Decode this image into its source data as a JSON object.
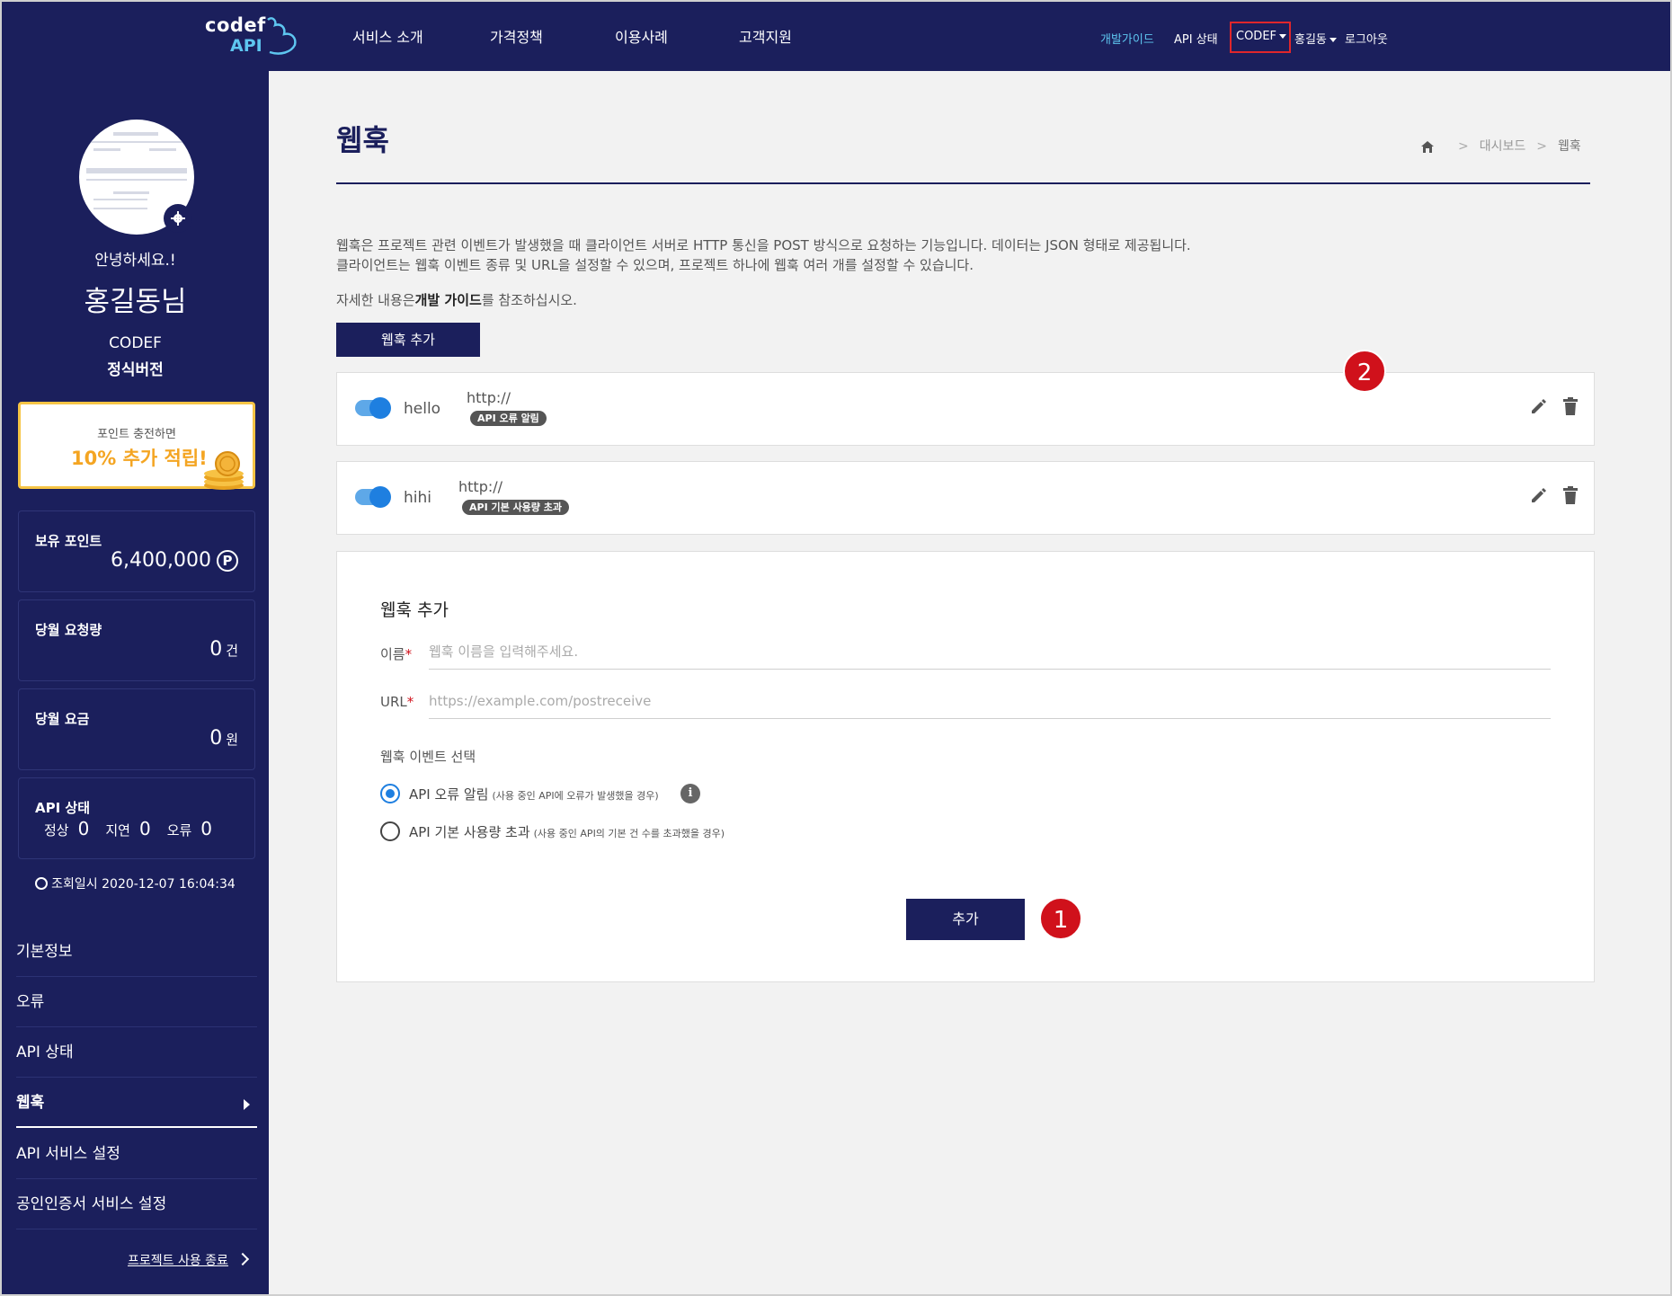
{
  "topnav": {
    "logo_top": "codef",
    "logo_bottom": "API",
    "menu": [
      "서비스 소개",
      "가격정책",
      "이용사례",
      "고객지원"
    ],
    "dev_guide": "개발가이드",
    "api_status": "API 상태",
    "codef": "CODEF",
    "user": "홍길동",
    "logout": "로그아웃"
  },
  "sidebar": {
    "greeting": "안녕하세요.!",
    "username": "홍길동님",
    "plan_name": "CODEF",
    "plan_type": "정식버전",
    "promo_line1": "포인트 충전하면",
    "promo_line2": "10% 추가 적립!",
    "points_label": "보유 포인트",
    "points_value": "6,400,000",
    "points_unit": "P",
    "requests_label": "당월 요청량",
    "requests_value": "0",
    "requests_unit": "건",
    "fee_label": "당월 요금",
    "fee_value": "0",
    "fee_unit": "원",
    "api_status_label": "API 상태",
    "status_normal_label": "정상",
    "status_normal": "0",
    "status_delay_label": "지연",
    "status_delay": "0",
    "status_error_label": "오류",
    "status_error": "0",
    "checked_at": "조회일시 2020-12-07 16:04:34",
    "menu": [
      {
        "label": "기본정보"
      },
      {
        "label": "오류"
      },
      {
        "label": "API 상태"
      },
      {
        "label": "웹훅"
      },
      {
        "label": "API 서비스 설정"
      },
      {
        "label": "공인인증서 서비스 설정"
      }
    ],
    "end_project": "프로젝트 사용 종료"
  },
  "main": {
    "title": "웹훅",
    "breadcrumb": [
      "대시보드",
      "웹훅"
    ],
    "desc_line1": "웹훅은 프로젝트 관련 이벤트가 발생했을 때 클라이언트 서버로 HTTP 통신을 POST 방식으로 요청하는 기능입니다. 데이터는 JSON 형태로 제공됩니다.",
    "desc_line2": "클라이언트는 웹훅 이벤트 종류 및 URL을 설정할 수 있으며, 프로젝트 하나에 웹훅 여러 개를 설정할 수 있습니다.",
    "guide_prefix": "자세한 내용은",
    "guide_link": "개발 가이드",
    "guide_suffix": "를 참조하십시오.",
    "add_button": "웹훅 추가",
    "hooks": [
      {
        "name": "hello",
        "url": "http://",
        "tag": "API 오류 알림",
        "enabled": true
      },
      {
        "name": "hihi",
        "url": "http://",
        "tag": "API 기본 사용량 초과",
        "enabled": true
      }
    ],
    "form": {
      "title": "웹훅 추가",
      "name_label": "이름",
      "name_placeholder": "웹훅 이름을 입력해주세요.",
      "url_label": "URL",
      "url_placeholder": "https://example.com/postreceive",
      "required_mark": "*",
      "event_title": "웹훅 이벤트 선택",
      "event1": "API 오류 알림",
      "event1_note": "(사용 중인 API에 오류가 발생했을 경우)",
      "event2": "API 기본 사용량 초과",
      "event2_note": "(사용 중인 API의 기본 건 수를 초과했을 경우)",
      "submit": "추가"
    },
    "badges": [
      "1",
      "2"
    ]
  },
  "colors": {
    "navy": "#1b1f5c",
    "accent": "#1e7fe0",
    "badge": "#d0111b",
    "promo": "#f4a522"
  }
}
